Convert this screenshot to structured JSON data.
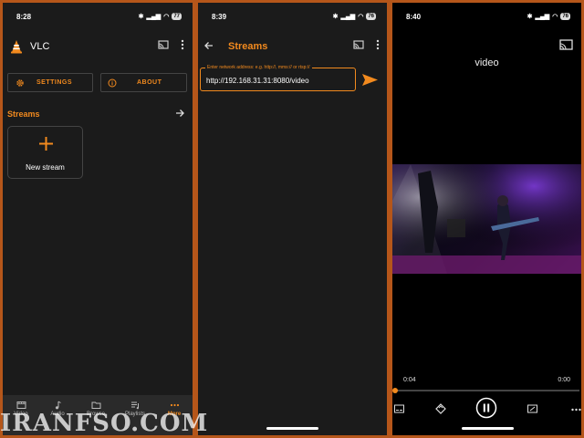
{
  "screen1": {
    "status": {
      "time": "8:28",
      "battery": "77"
    },
    "app_title": "VLC",
    "settings_label": "SETTINGS",
    "about_label": "ABOUT",
    "streams_heading": "Streams",
    "new_stream_label": "New stream",
    "nav": [
      {
        "label": "Video",
        "icon": "video-icon"
      },
      {
        "label": "Audio",
        "icon": "music-note-icon"
      },
      {
        "label": "Browse",
        "icon": "folder-icon"
      },
      {
        "label": "Playlists",
        "icon": "playlist-icon"
      },
      {
        "label": "More",
        "icon": "more-dots-icon",
        "active": true
      }
    ]
  },
  "screen2": {
    "status": {
      "time": "8:39",
      "battery": "76"
    },
    "title": "Streams",
    "input_label": "Enter network address: e.g. http://, mms:// or rtsp://",
    "input_value": "http://192.168.31.31:8080/video"
  },
  "screen3": {
    "status": {
      "time": "8:40",
      "battery": "76"
    },
    "video_title": "video",
    "elapsed": "0:04",
    "duration": "0:00",
    "progress": 0
  },
  "watermark": "IRANFSO.COM",
  "colors": {
    "accent": "#f28a1e",
    "background": "#1b1b1b",
    "frame": "#b5561a"
  }
}
